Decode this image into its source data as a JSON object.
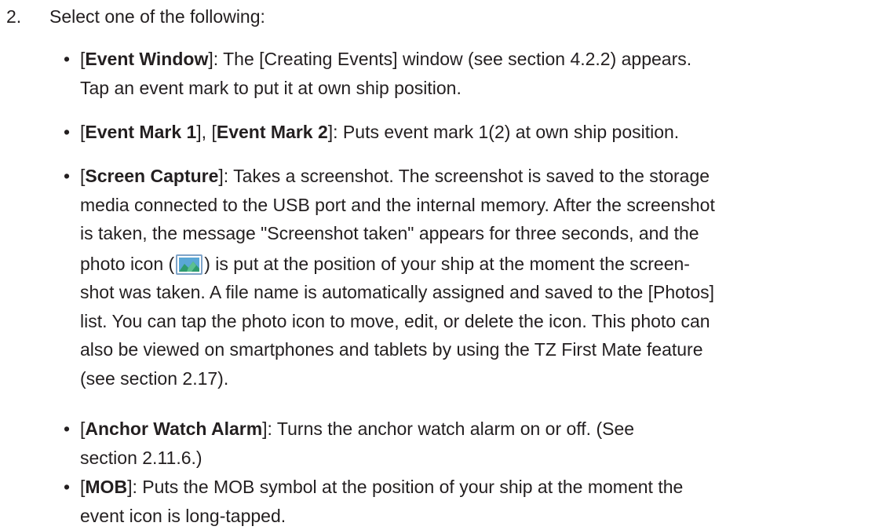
{
  "step": {
    "number": "2.",
    "text": "Select one of the following:"
  },
  "bullet_symbol": "•",
  "items": [
    {
      "title": "Event Window",
      "lines": [
        "]: The [Creating Events] window (see section 4.2.2) appears.",
        "Tap an event mark to put it at own ship position."
      ]
    },
    {
      "title": "Event Mark 1",
      "middle": "], [",
      "title2": "Event Mark 2",
      "lines": [
        "]: Puts event mark 1(2) at own ship position."
      ]
    },
    {
      "title": "Screen Capture",
      "lines": [
        "]: Takes a screenshot. The screenshot is saved to the storage",
        "media connected to the USB port and the internal memory. After the screenshot",
        "is taken, the message \"Screenshot taken\" appears for three seconds, and the"
      ],
      "icon_line_before": "photo icon (",
      "icon_line_after": ") is put at the position of your ship at the moment the screen-",
      "lines_after": [
        "shot was taken. A file name is automatically assigned and saved to the [Photos]",
        "list. You can tap the photo icon to move, edit, or delete the icon. This photo can",
        "also be viewed on smartphones and tablets by using the TZ First Mate feature",
        "(see section 2.17)."
      ]
    },
    {
      "title": "Anchor Watch Alarm",
      "lines": [
        "]: Turns the anchor watch alarm on or off. (See",
        "section 2.11.6.)"
      ]
    },
    {
      "title": "MOB",
      "lines": [
        "]: Puts the MOB symbol at the position of your ship at the moment the",
        "event icon is long-tapped."
      ]
    }
  ],
  "photo_icon": {
    "name": "photo-icon",
    "colors": {
      "frame": "#7ea3c8",
      "sky": "#5aa7d6",
      "mountain": "#2f9b6e",
      "mountain_light": "#5cc08f"
    }
  }
}
